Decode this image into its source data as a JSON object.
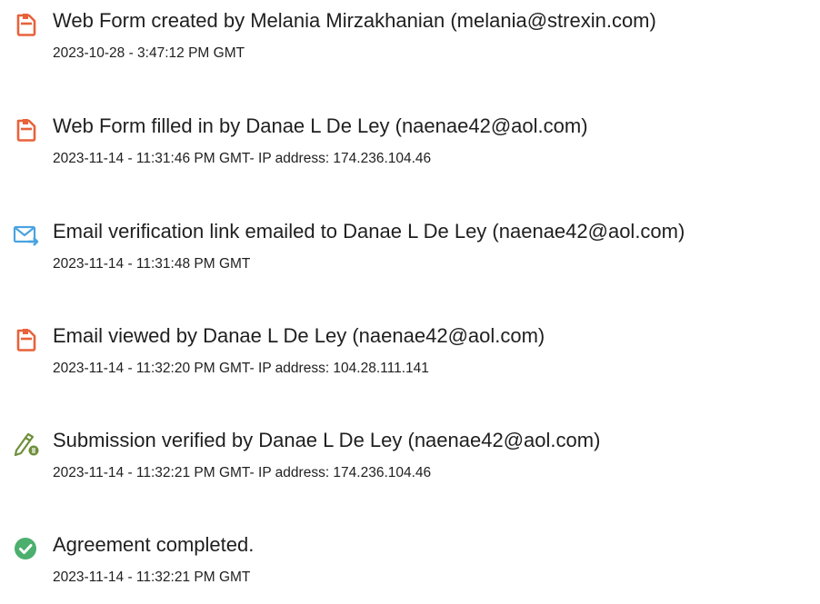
{
  "events": [
    {
      "icon": "document-icon",
      "title": "Web Form created by Melania Mirzakhanian (melania@strexin.com)",
      "meta": "2023-10-28 - 3:47:12 PM GMT"
    },
    {
      "icon": "document-icon",
      "title": "Web Form filled in by Danae L De Ley (naenae42@aol.com)",
      "meta": "2023-11-14 - 11:31:46 PM GMT- IP address: 174.236.104.46"
    },
    {
      "icon": "email-forward-icon",
      "title": "Email verification link emailed to Danae L De Ley (naenae42@aol.com)",
      "meta": "2023-11-14 - 11:31:48 PM GMT"
    },
    {
      "icon": "document-icon",
      "title": "Email viewed by Danae L De Ley (naenae42@aol.com)",
      "meta": "2023-11-14 - 11:32:20 PM GMT- IP address: 104.28.111.141"
    },
    {
      "icon": "pen-verified-icon",
      "title": "Submission verified by Danae L De Ley (naenae42@aol.com)",
      "meta": "2023-11-14 - 11:32:21 PM GMT- IP address: 174.236.104.46"
    },
    {
      "icon": "checkmark-circle-icon",
      "title": "Agreement completed.",
      "meta": "2023-11-14 - 11:32:21 PM GMT"
    }
  ],
  "colors": {
    "document_icon": "#e8623a",
    "email_icon": "#4aa3e0",
    "pen_icon": "#6f8f3a",
    "check_icon": "#4caf6e"
  }
}
